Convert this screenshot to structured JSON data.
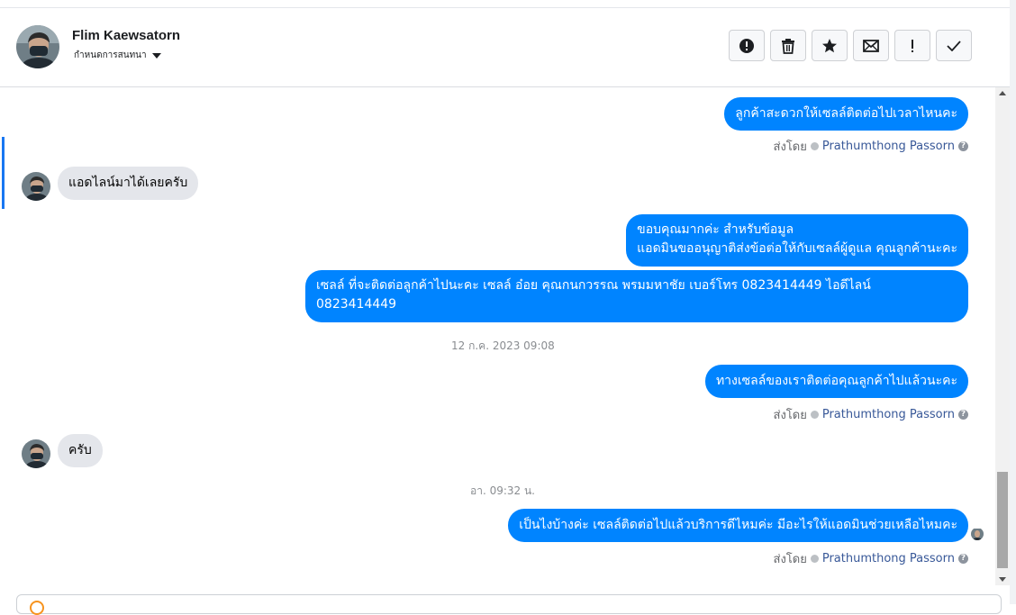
{
  "header": {
    "contact_name": "Flim Kaewsatorn",
    "conversation_setting": "กำหนดการสนทนา",
    "toolbar": [
      {
        "name": "report-spam-button",
        "icon": "alert-circle-icon"
      },
      {
        "name": "delete-button",
        "icon": "trash-icon"
      },
      {
        "name": "star-button",
        "icon": "star-icon"
      },
      {
        "name": "mark-unread-button",
        "icon": "envelope-icon"
      },
      {
        "name": "follow-up-button",
        "icon": "exclamation-icon"
      },
      {
        "name": "mark-done-button",
        "icon": "checkmark-icon"
      }
    ]
  },
  "messages": {
    "m1": {
      "text": "ลูกค้าสะดวกให้เซลล์ติดต่อไปเวลาไหนคะ"
    },
    "m1_sent": {
      "prefix": "ส่งโดย",
      "agent": "Prathumthong Passorn"
    },
    "m2": {
      "text": "แอดไลน์มาได้เลยครับ"
    },
    "m3": {
      "line1": "ขอบคุณมากค่ะ สำหรับข้อมูล",
      "line2": "แอดมินขออนุญาติส่งข้อต่อให้กับเซลล์ผู้ดูแล คุณลูกค้านะคะ"
    },
    "m4": {
      "line1": "เซลล์ ที่จะติดต่อลูกค้าไปนะคะ เซลล์ อ๋อย คุณกนกวรรณ พรมมหาชัย เบอร์โทร 0823414449 ไอดีไลน์",
      "line2": "0823414449"
    },
    "ts1": "12 ก.ค. 2023 09:08",
    "m5": {
      "text": "ทางเซลล์ของเราติดต่อคุณลูกค้าไปแล้วนะคะ"
    },
    "m5_sent": {
      "prefix": "ส่งโดย",
      "agent": "Prathumthong Passorn"
    },
    "m6": {
      "text": "ครับ"
    },
    "ts2": "อา. 09:32 น.",
    "m7": {
      "text": "เป็นไงบ้างค่ะ เซลล์ติดต่อไปแล้วบริการดีไหมค่ะ มีอะไรให้แอดมินช่วยเหลือไหมคะ"
    },
    "m7_sent": {
      "prefix": "ส่งโดย",
      "agent": "Prathumthong Passorn"
    },
    "help_glyph": "?"
  },
  "colors": {
    "outgoing_bubble": "#0084ff",
    "incoming_bubble": "#e4e6eb",
    "agent_link": "#385898",
    "active_indicator": "#1877f2"
  }
}
